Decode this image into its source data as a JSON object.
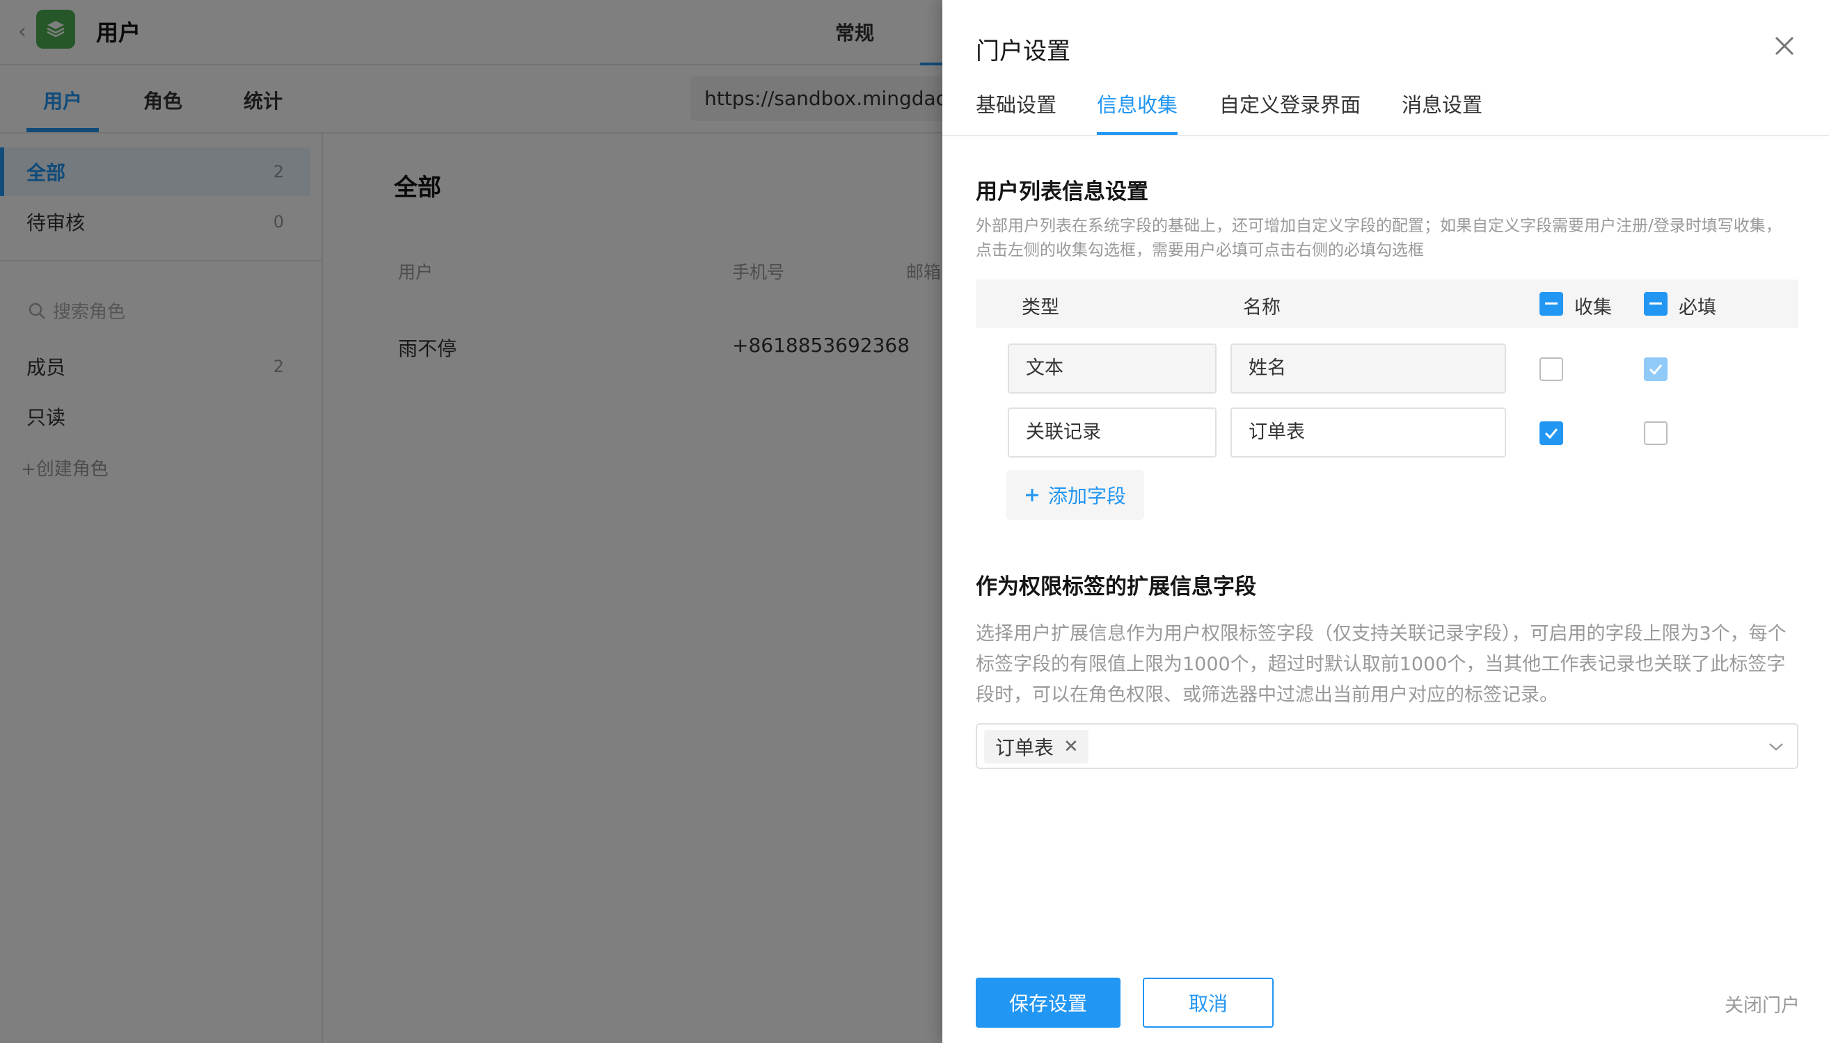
{
  "app": {
    "title": "用户",
    "header_nav": "常规",
    "tabs": [
      "用户",
      "角色",
      "统计"
    ],
    "url": "https://sandbox.mingdao.com/portal/…"
  },
  "sidebar": {
    "status_items": [
      {
        "label": "全部",
        "count": "2"
      },
      {
        "label": "待审核",
        "count": "0"
      }
    ],
    "search_placeholder": "搜索角色",
    "role_items": [
      {
        "label": "成员",
        "count": "2"
      },
      {
        "label": "只读",
        "count": ""
      }
    ],
    "create_role": "+创建角色"
  },
  "content": {
    "title": "全部",
    "columns": [
      "用户",
      "手机号",
      "邮箱"
    ],
    "rows": [
      {
        "user": "雨不停",
        "phone": "+8618853692368"
      }
    ]
  },
  "drawer": {
    "title": "门户设置",
    "tabs": [
      "基础设置",
      "信息收集",
      "自定义登录界面",
      "消息设置"
    ],
    "active_tab": "信息收集",
    "section1": {
      "title": "用户列表信息设置",
      "desc": "外部用户列表在系统字段的基础上，还可增加自定义字段的配置；如果自定义字段需要用户注册/登录时填写收集，点击左侧的收集勾选框，需要用户必填可点击右侧的必填勾选框",
      "headers": {
        "type": "类型",
        "name": "名称",
        "collect": "收集",
        "required": "必填"
      },
      "rows": [
        {
          "type": "文本",
          "name": "姓名",
          "collect": false,
          "required": true,
          "required_disabled": true
        },
        {
          "type": "关联记录",
          "name": "订单表",
          "collect": true,
          "required": false,
          "required_disabled": false
        }
      ],
      "add_field": "添加字段"
    },
    "section2": {
      "title": "作为权限标签的扩展信息字段",
      "desc": "选择用户扩展信息作为用户权限标签字段（仅支持关联记录字段），可启用的字段上限为3个，每个标签字段的有限值上限为1000个，超过时默认取前1000个，当其他工作表记录也关联了此标签字段时，可以在角色权限、或筛选器中过滤出当前用户对应的标签记录。",
      "selected_tags": [
        "订单表"
      ]
    },
    "footer": {
      "save": "保存设置",
      "cancel": "取消",
      "close_portal": "关闭门户"
    }
  },
  "colors": {
    "accent": "#2196f3",
    "logo": "#4caf50"
  }
}
